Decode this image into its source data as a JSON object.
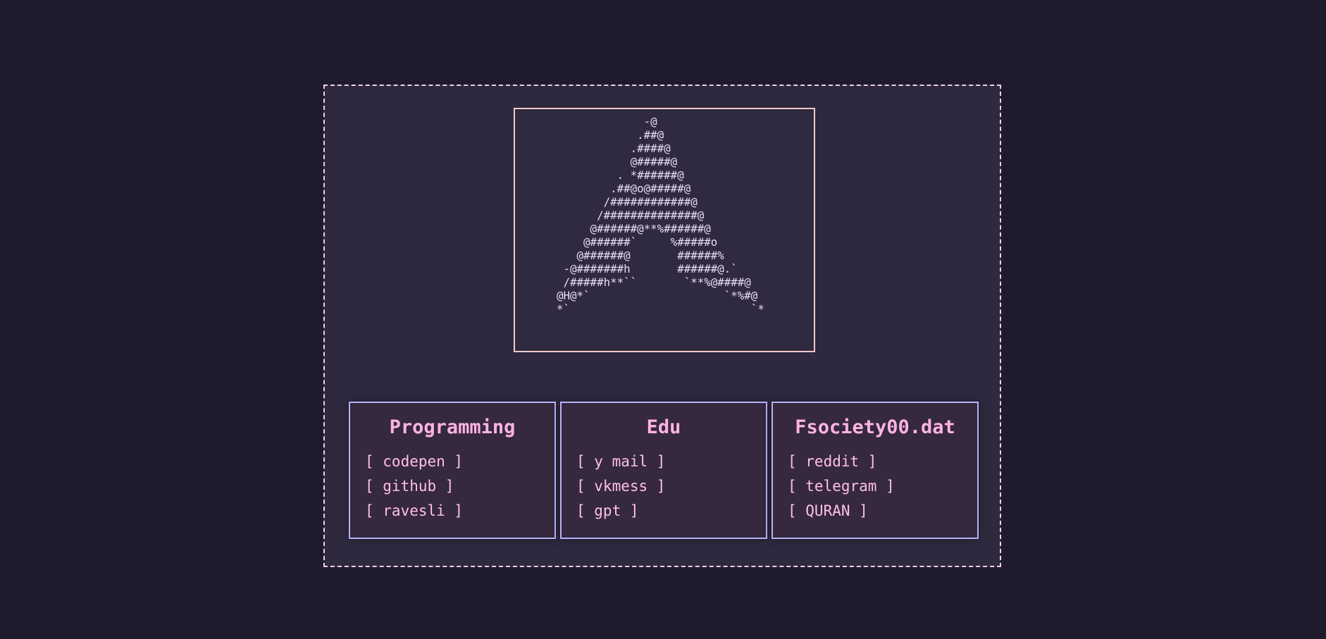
{
  "ascii_logo": {
    "lines": [
      "             -@",
      "            .##@",
      "           .####@",
      "           @#####@",
      "         . *######@",
      "        .##@o@#####@",
      "       /############@",
      "      /##############@",
      "     @######@**%######@",
      "    @######`     %#####o",
      "   @######@       ######%",
      " -@#######h       ######@.`",
      " /#####h**``       `**%@####@",
      "@H@*`                    `*%#@",
      "*`                           `*"
    ]
  },
  "cards": [
    {
      "title": "Programming",
      "links": [
        "[ codepen ]",
        "[ github ]",
        "[ ravesli ]"
      ]
    },
    {
      "title": "Edu",
      "links": [
        "[ y mail ]",
        "[ vkmess ]",
        "[ gpt ]"
      ]
    },
    {
      "title": "Fsociety00.dat",
      "links": [
        "[ reddit ]",
        "[ telegram ]",
        "[ QURAN ]"
      ]
    }
  ],
  "colors": {
    "background": "#1f1b2d",
    "frame_border": "#f2cfe6",
    "ascii_border": "#f6c8c8",
    "card_border": "#b9b1f6",
    "accent_pink": "#ffb3e0"
  }
}
